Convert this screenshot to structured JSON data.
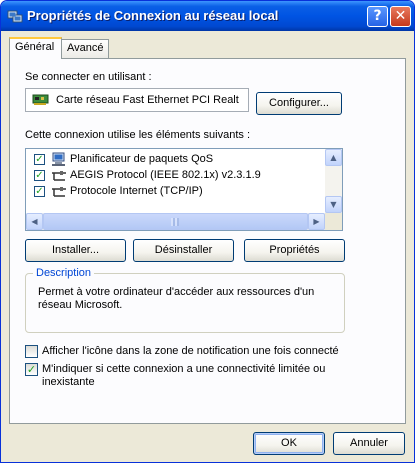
{
  "window": {
    "title": "Propriétés de Connexion au réseau local",
    "help_glyph": "?",
    "close_glyph": "✕"
  },
  "tabs": [
    {
      "label": "Général",
      "active": true
    },
    {
      "label": "Avancé",
      "active": false
    }
  ],
  "general": {
    "connect_using_label": "Se connecter en utilisant :",
    "adapter_name": "Carte réseau Fast Ethernet PCI Realt",
    "configure_button": "Configurer...",
    "components_label": "Cette connexion utilise les éléments suivants :",
    "components": [
      {
        "label": "Planificateur de paquets QoS",
        "checked": true,
        "icon": "qos-scheduler-icon"
      },
      {
        "label": "AEGIS Protocol (IEEE 802.1x) v2.3.1.9",
        "checked": true,
        "icon": "protocol-icon"
      },
      {
        "label": "Protocole Internet (TCP/IP)",
        "checked": true,
        "icon": "protocol-icon"
      }
    ],
    "install_button": "Installer...",
    "uninstall_button": "Désinstaller",
    "properties_button": "Propriétés",
    "description_title": "Description",
    "description_text": "Permet à votre ordinateur d'accéder aux ressources d'un réseau Microsoft.",
    "show_icon_label": "Afficher l'icône dans la zone de notification une fois connecté",
    "show_icon_checked": false,
    "notify_limited_label": "M'indiquer si cette connexion a une connectivité limitée ou inexistante",
    "notify_limited_checked": true
  },
  "footer": {
    "ok_button": "OK",
    "cancel_button": "Annuler"
  },
  "colors": {
    "titlebar": "#0054e3",
    "dialog_face": "#ece9d8",
    "group_title": "#0046d5",
    "check_mark": "#21a121"
  }
}
